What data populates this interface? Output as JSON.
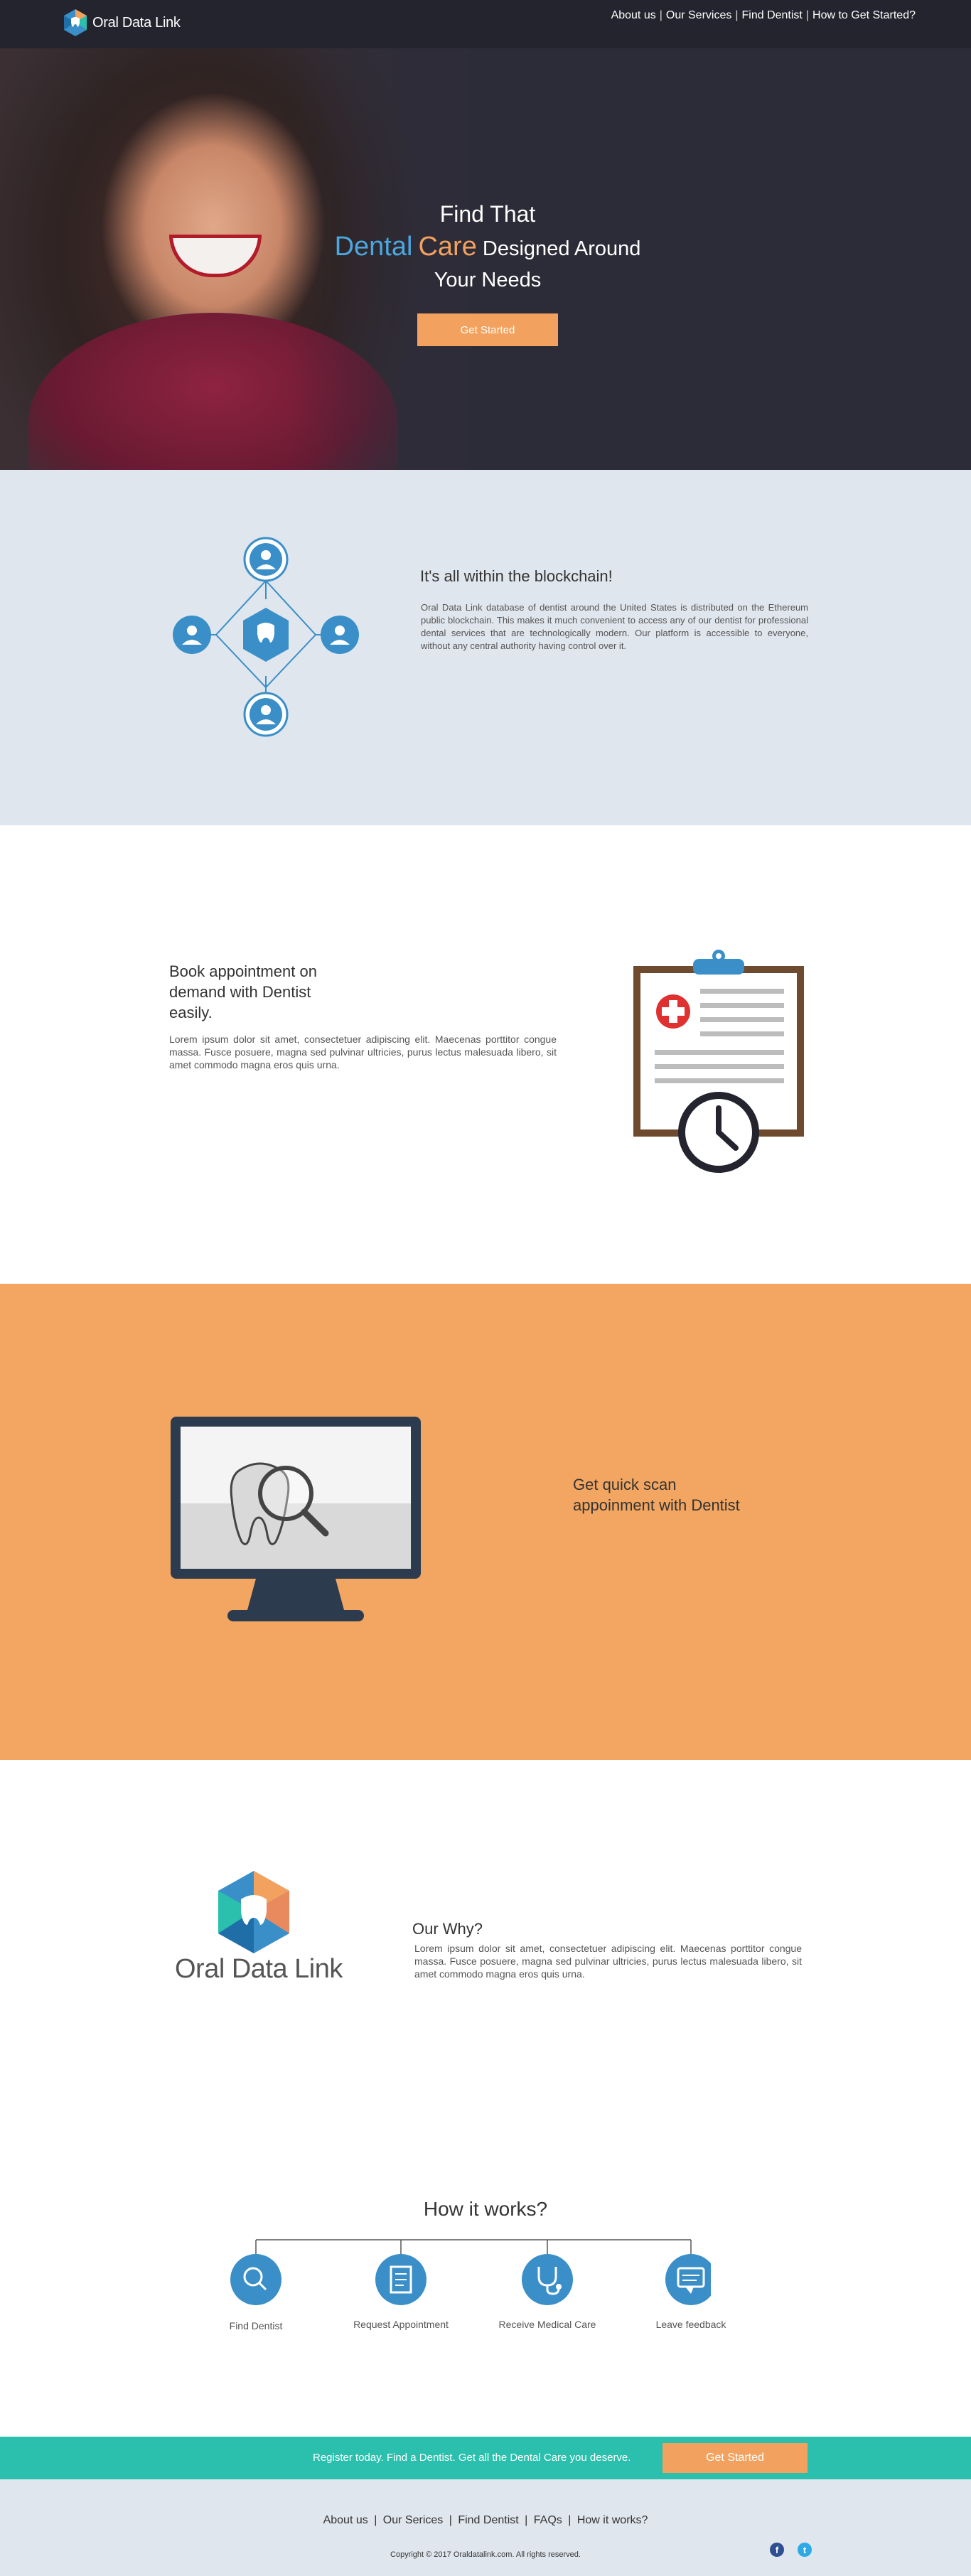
{
  "brand": {
    "name": "Oral Data Link"
  },
  "nav": {
    "items": [
      "About us",
      "Our Services",
      "Find Dentist",
      "How to Get Started?"
    ]
  },
  "hero": {
    "line1": "Find That",
    "word_dental": "Dental",
    "word_care": "Care",
    "line2_rest": " Designed Around",
    "line3": "Your Needs",
    "cta": "Get Started"
  },
  "blockchain": {
    "title": "It's all within the blockchain!",
    "body": "Oral Data Link database of dentist around the United States is distributed on the Ethereum public blockchain. This makes it much convenient to access any of our dentist for professional dental services that are technologically modern. Our platform is accessible to everyone, without any central authority having control over it."
  },
  "book": {
    "title": "Book appointment on demand with Dentist easily.",
    "body": "Lorem ipsum dolor sit amet, consectetuer adipiscing elit. Maecenas porttitor congue massa. Fusce posuere, magna sed pulvinar ultricies, purus lectus malesuada libero, sit amet commodo magna eros quis urna."
  },
  "scan": {
    "title": "Get quick scan appoinment with Dentist"
  },
  "why": {
    "logo_text": "Oral Data Link",
    "title": "Our Why?",
    "body": "Lorem ipsum dolor sit amet, consectetuer adipiscing elit. Maecenas porttitor congue massa. Fusce posuere, magna sed pulvinar ultricies, purus lectus malesuada libero, sit amet commodo magna eros quis urna."
  },
  "how": {
    "title": "How it works?",
    "steps": [
      {
        "label": "Find Dentist",
        "icon": "search-icon"
      },
      {
        "label": "Request Appointment",
        "icon": "document-icon"
      },
      {
        "label": "Receive Medical Care",
        "icon": "stethoscope-icon"
      },
      {
        "label": "Leave feedback",
        "icon": "chat-icon"
      }
    ]
  },
  "cta": {
    "text": "Register today. Find a Dentist. Get all the Dental Care you deserve.",
    "button": "Get Started"
  },
  "footer": {
    "nav": [
      "About us",
      "Our Serices",
      "Find Dentist",
      "FAQs",
      "How it works?"
    ],
    "copyright": "Copyright © 2017 Oraldatalink.com. All rights reserved.",
    "social": [
      "facebook-icon",
      "twitter-icon"
    ]
  },
  "colors": {
    "header_bg": "#24242f",
    "accent_blue": "#3a8fc9",
    "accent_orange": "#f2a25e",
    "teal": "#2bbfad",
    "light_gray_bg": "#e0e6ed"
  }
}
